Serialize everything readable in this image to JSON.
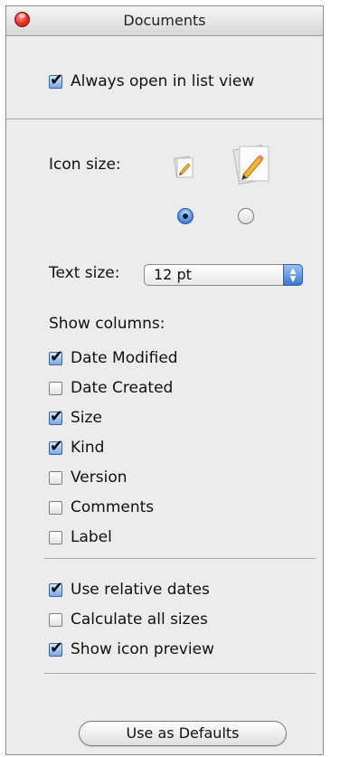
{
  "window": {
    "title": "Documents"
  },
  "always_open_list_view": {
    "label": "Always open in list view",
    "checked": true
  },
  "icon_size": {
    "label": "Icon size:",
    "options": [
      {
        "icon": "document-icon-small",
        "selected": true
      },
      {
        "icon": "document-icon-large",
        "selected": false
      }
    ]
  },
  "text_size": {
    "label": "Text size:",
    "value": "12 pt"
  },
  "show_columns": {
    "label": "Show columns:",
    "items": [
      {
        "label": "Date Modified",
        "checked": true
      },
      {
        "label": "Date Created",
        "checked": false
      },
      {
        "label": "Size",
        "checked": true
      },
      {
        "label": "Kind",
        "checked": true
      },
      {
        "label": "Version",
        "checked": false
      },
      {
        "label": "Comments",
        "checked": false
      },
      {
        "label": "Label",
        "checked": false
      }
    ]
  },
  "options": {
    "items": [
      {
        "label": "Use relative dates",
        "checked": true
      },
      {
        "label": "Calculate all sizes",
        "checked": false
      },
      {
        "label": "Show icon preview",
        "checked": true
      }
    ]
  },
  "defaults_button": {
    "label": "Use as Defaults"
  }
}
